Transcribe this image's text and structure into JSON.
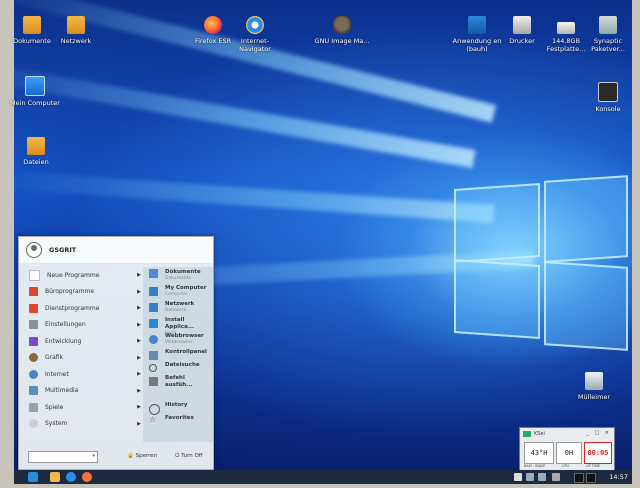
{
  "desktop": {
    "icons_left": [
      {
        "label": "Dokumente",
        "icon": "folder-icon"
      },
      {
        "label": "Netzwerk",
        "icon": "network-folder-icon"
      },
      {
        "label": "Mein Computer",
        "icon": "computer-icon"
      },
      {
        "label": "Dateien",
        "icon": "folder-icon"
      }
    ],
    "icons_top": [
      {
        "label": "Firefox ESR",
        "icon": "firefox-icon"
      },
      {
        "label": "Internet-Navigator",
        "icon": "internet-explorer-icon"
      },
      {
        "label": "GNU Image Ma...",
        "icon": "gimp-icon"
      },
      {
        "label": "Anwendung en (bauh)",
        "icon": "app-store-icon"
      },
      {
        "label": "Drucker",
        "icon": "printer-icon"
      },
      {
        "label": "144.8GB Festplatte...",
        "icon": "hard-disk-icon"
      },
      {
        "label": "Synaptic Paketver...",
        "icon": "package-manager-icon"
      }
    ],
    "console": {
      "label": "Konsole",
      "icon": "terminal-icon"
    },
    "trash": {
      "label": "Mülleimer",
      "icon": "trash-icon"
    }
  },
  "start_menu": {
    "username": "GSGRIT",
    "categories": [
      {
        "label": "Neue Programme",
        "color": "#ffffff"
      },
      {
        "label": "Büroprogramme",
        "color": "#d9482b"
      },
      {
        "label": "Dienstprogramme",
        "color": "#d9482b"
      },
      {
        "label": "Einstellungen",
        "color": "#8a8f96"
      },
      {
        "label": "Entwicklung",
        "color": "#7a4cc2"
      },
      {
        "label": "Grafik",
        "color": "#8a6a3a"
      },
      {
        "label": "Internet",
        "color": "#4a80c9"
      },
      {
        "label": "Multimedia",
        "color": "#5b8fb9"
      },
      {
        "label": "Spiele",
        "color": "#9aa0a6"
      },
      {
        "label": "System",
        "color": "#c9ced2"
      }
    ],
    "places": [
      {
        "title": "Dokumente",
        "sub": "Dokumente"
      },
      {
        "title": "My Computer",
        "sub": "Computer"
      },
      {
        "title": "Netzwerk",
        "sub": "Netzwerk"
      },
      {
        "title": "Install Applica...",
        "sub": "bauh"
      },
      {
        "title": "Webbrowser",
        "sub": "Webbrowser"
      },
      {
        "title": "Kontrollpanel",
        "sub": ""
      },
      {
        "title": "Dateisuche",
        "sub": ""
      },
      {
        "title": "Befehl ausfüh...",
        "sub": ""
      },
      {
        "title": "History",
        "sub": ""
      },
      {
        "title": "Favorites",
        "sub": ""
      }
    ],
    "lock_label": "Sperren",
    "shutdown_label": "Turn Off"
  },
  "clock_widget": {
    "title": "KSei",
    "cells": [
      {
        "value": "43°H",
        "caption": "RAM · SWAP"
      },
      {
        "value": "0H",
        "caption": "CPU"
      },
      {
        "value": "00:05",
        "caption": "UP TIME"
      }
    ]
  },
  "taskbar": {
    "time": "14:57"
  }
}
